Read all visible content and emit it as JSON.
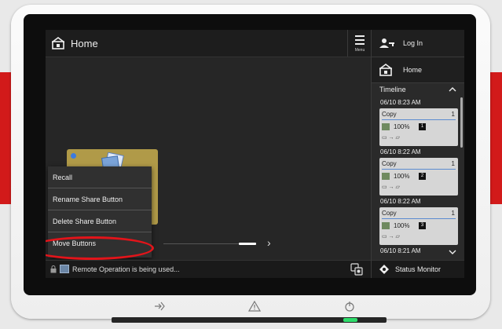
{
  "main": {
    "title": "Home",
    "menu_label": "Menu"
  },
  "context_menu": {
    "items": [
      "Recall",
      "Rename Share Button",
      "Delete Share Button",
      "Move Buttons"
    ]
  },
  "status_bar": {
    "message": "Remote Operation is being used..."
  },
  "right_panel": {
    "login_label": "Log In",
    "home_label": "Home",
    "timeline_label": "Timeline",
    "jobs": [
      {
        "time": "06/10 8:23 AM",
        "name": "Copy",
        "count": "1",
        "percent": "100%",
        "index": "1"
      },
      {
        "time": "06/10 8:22 AM",
        "name": "Copy",
        "count": "1",
        "percent": "100%",
        "index": "2"
      },
      {
        "time": "06/10 8:22 AM",
        "name": "Copy",
        "count": "1",
        "percent": "100%",
        "index": "3"
      },
      {
        "time": "06/10 8:21 AM"
      }
    ],
    "status_monitor_label": "Status Monitor"
  },
  "colors": {
    "accent_red": "#d21a1a",
    "highlight_ring": "#e2141a",
    "share_card": "#b09a48",
    "led_green": "#2fdc6b"
  },
  "icons": [
    "home-icon",
    "menu-icon",
    "login-icon",
    "chevron-up-icon",
    "chevron-down-icon",
    "lock-icon",
    "remote-icon",
    "share-status-icon",
    "status-monitor-icon",
    "energy-saver-icon",
    "warning-icon",
    "power-icon"
  ]
}
